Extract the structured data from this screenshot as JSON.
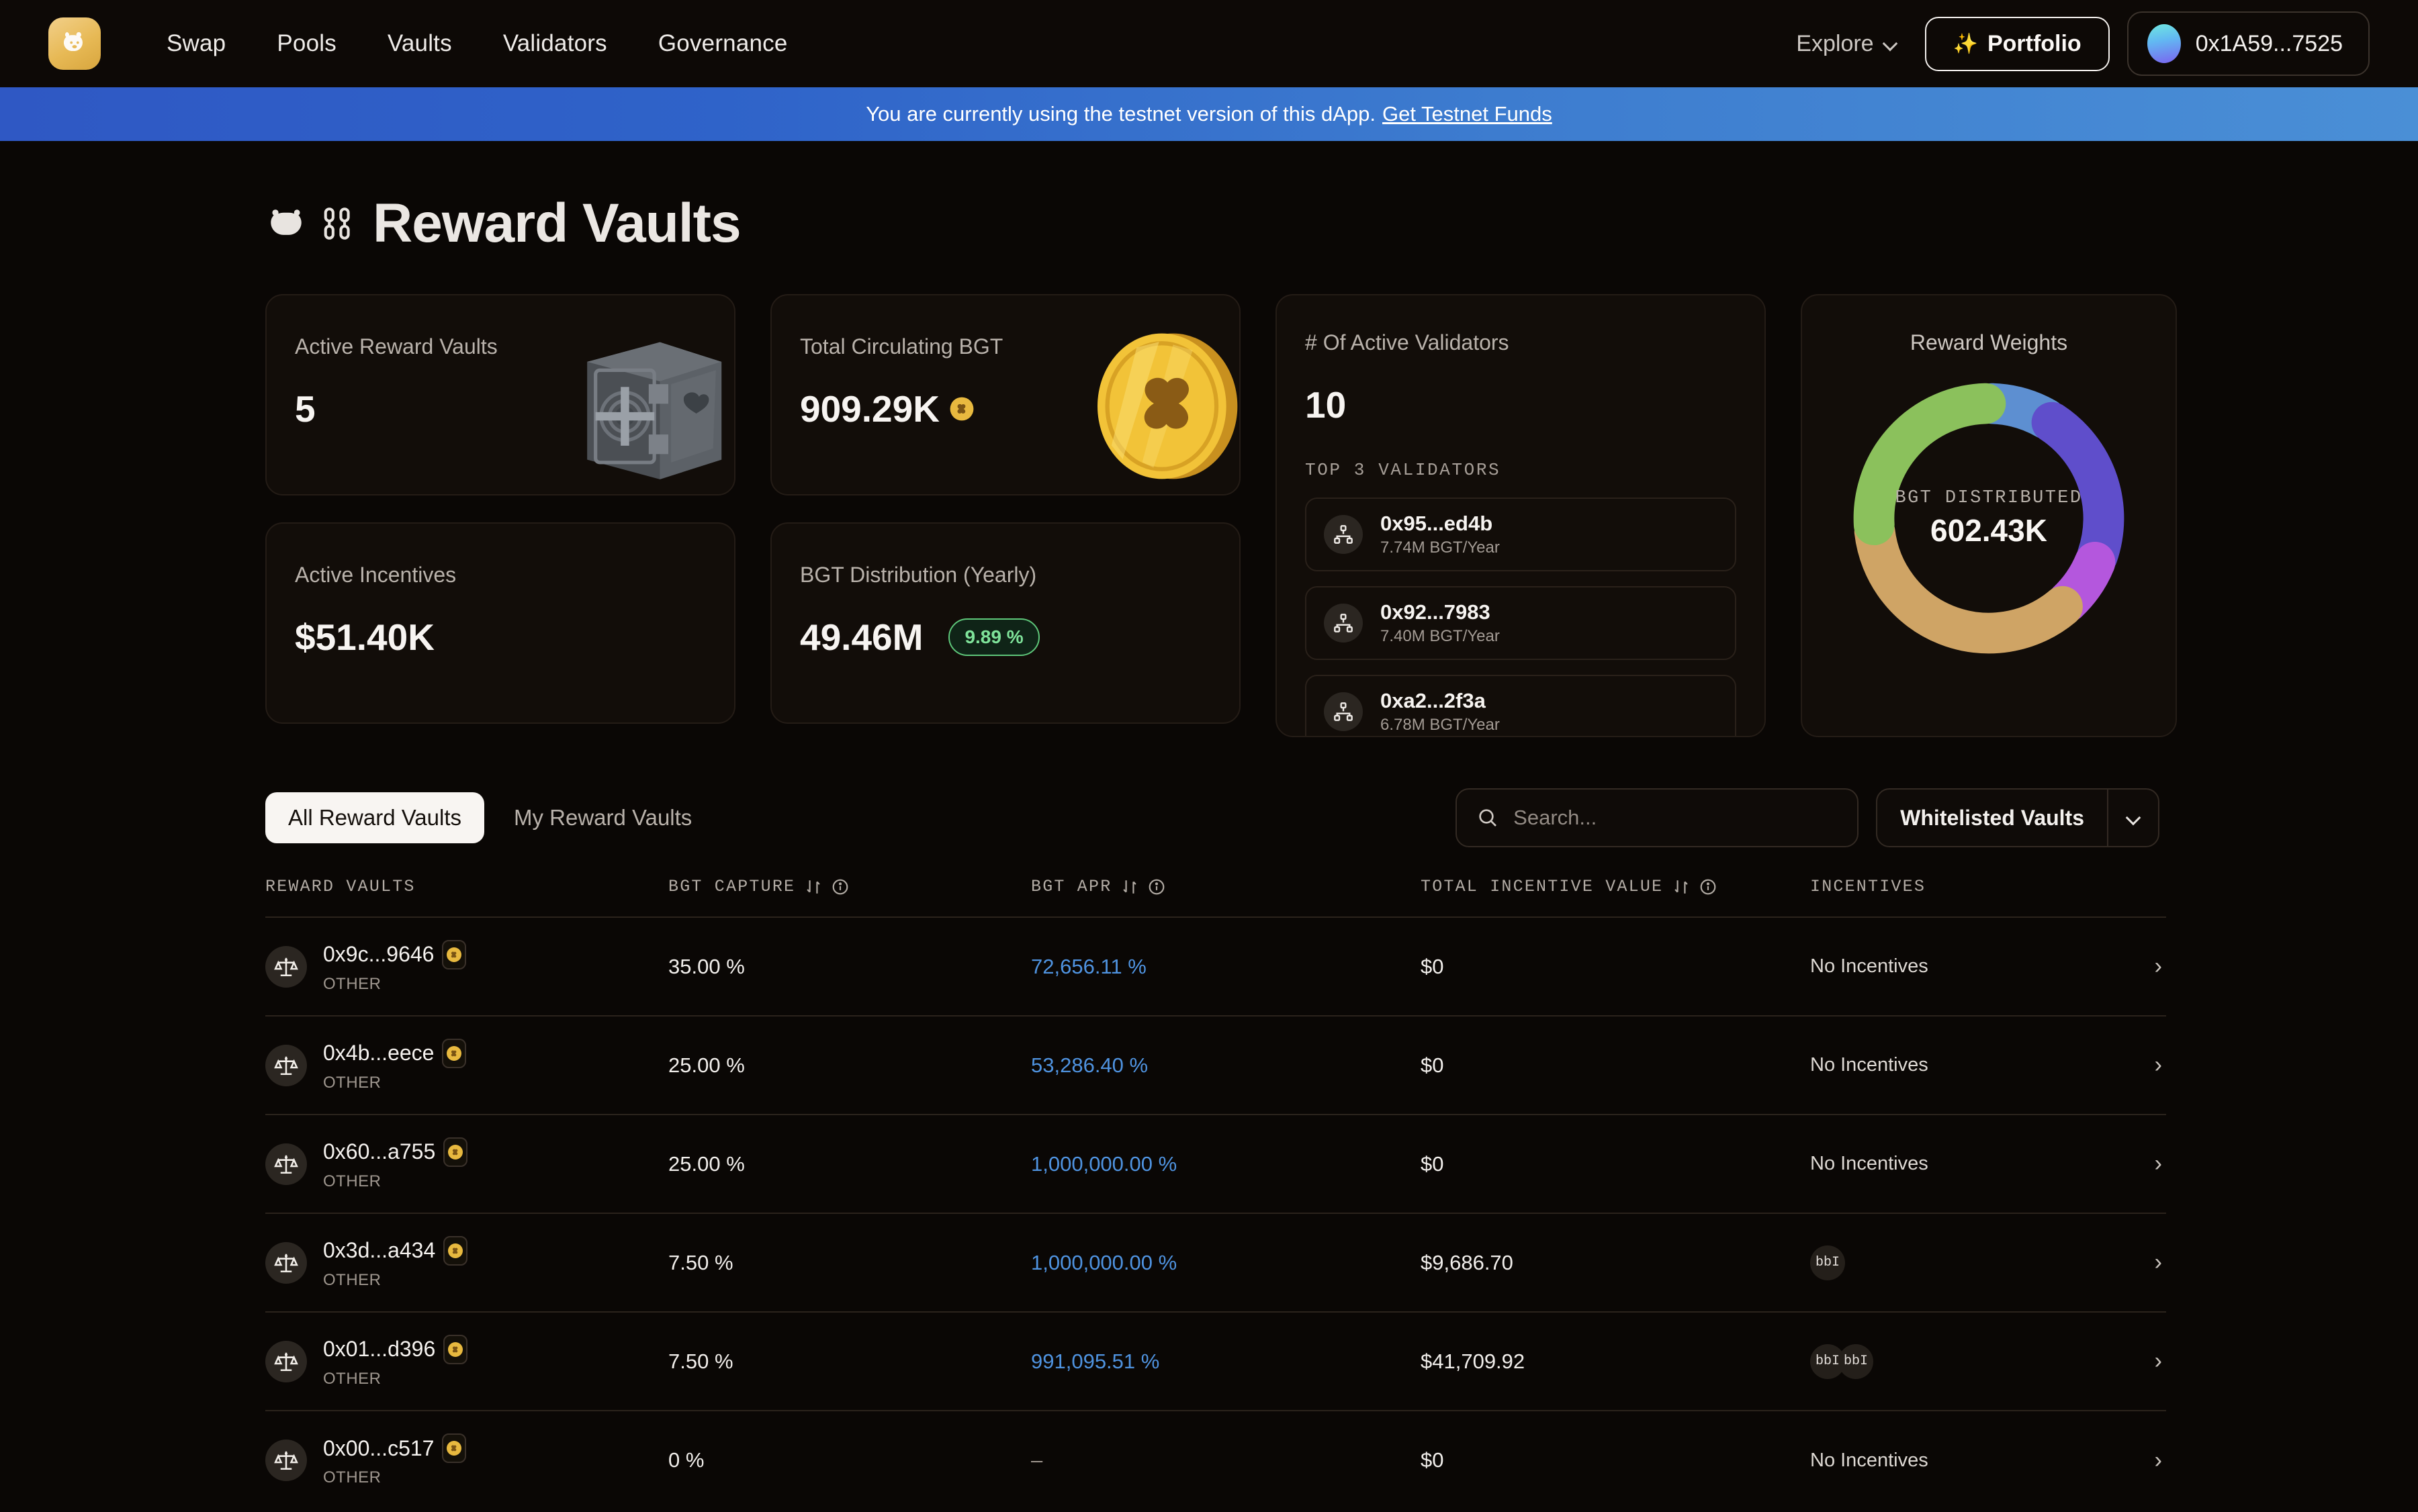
{
  "nav": {
    "logo_icon": "bera-logo-icon",
    "links": [
      "Swap",
      "Pools",
      "Vaults",
      "Validators",
      "Governance"
    ],
    "explore_label": "Explore",
    "portfolio_label": "Portfolio",
    "wallet_address": "0x1A59...7525"
  },
  "banner": {
    "text": "You are currently using the testnet version of this dApp.",
    "link_label": "Get Testnet Funds"
  },
  "page": {
    "title": "Reward Vaults"
  },
  "stats": {
    "active_reward_vaults": {
      "label": "Active Reward Vaults",
      "value": "5"
    },
    "total_circulating_bgt": {
      "label": "Total Circulating BGT",
      "value": "909.29K"
    },
    "active_incentives": {
      "label": "Active Incentives",
      "value": "$51.40K"
    },
    "bgt_distribution": {
      "label": "BGT Distribution (Yearly)",
      "value": "49.46M",
      "badge": "9.89 %"
    },
    "validators": {
      "label": "# Of Active Validators",
      "value": "10",
      "sublabel": "TOP 3 VALIDATORS",
      "items": [
        {
          "name": "0x95...ed4b",
          "rate": "7.74M BGT/Year"
        },
        {
          "name": "0x92...7983",
          "rate": "7.40M BGT/Year"
        },
        {
          "name": "0xa2...2f3a",
          "rate": "6.78M BGT/Year"
        }
      ]
    },
    "reward_weights": {
      "title": "Reward Weights",
      "center_label": "BGT DISTRIBUTED",
      "center_value": "602.43K"
    }
  },
  "chart_data": {
    "type": "pie",
    "title": "Reward Weights",
    "center_label": "BGT DISTRIBUTED",
    "center_value": "602.43K",
    "legend": "none",
    "categories": [
      "segment-1",
      "segment-2",
      "segment-3",
      "segment-4",
      "segment-5"
    ],
    "values": [
      8,
      20,
      7,
      32,
      24
    ],
    "colors": [
      "#5d8fd1",
      "#5f4ecb",
      "#b457dd",
      "#cfa465",
      "#8bc15c"
    ]
  },
  "controls": {
    "tabs": [
      {
        "label": "All Reward Vaults",
        "active": true
      },
      {
        "label": "My Reward Vaults",
        "active": false
      }
    ],
    "search": {
      "placeholder": "Search...",
      "value": ""
    },
    "filter": {
      "selected": "Whitelisted Vaults"
    }
  },
  "table": {
    "columns": [
      {
        "label": "REWARD VAULTS",
        "sortable": false,
        "info": false
      },
      {
        "label": "BGT CAPTURE",
        "sortable": true,
        "info": true
      },
      {
        "label": "BGT APR",
        "sortable": true,
        "info": true
      },
      {
        "label": "TOTAL INCENTIVE VALUE",
        "sortable": true,
        "info": true
      },
      {
        "label": "INCENTIVES",
        "sortable": false,
        "info": false
      }
    ],
    "rows": [
      {
        "name": "0x9c...9646",
        "type": "OTHER",
        "capture": "35.00 %",
        "apr": "72,656.11 %",
        "apr_muted": false,
        "incentive_value": "$0",
        "incentives": "No Incentives",
        "chips": []
      },
      {
        "name": "0x4b...eece",
        "type": "OTHER",
        "capture": "25.00 %",
        "apr": "53,286.40 %",
        "apr_muted": false,
        "incentive_value": "$0",
        "incentives": "No Incentives",
        "chips": []
      },
      {
        "name": "0x60...a755",
        "type": "OTHER",
        "capture": "25.00 %",
        "apr": "1,000,000.00 %",
        "apr_muted": false,
        "incentive_value": "$0",
        "incentives": "No Incentives",
        "chips": []
      },
      {
        "name": "0x3d...a434",
        "type": "OTHER",
        "capture": "7.50 %",
        "apr": "1,000,000.00 %",
        "apr_muted": false,
        "incentive_value": "$9,686.70",
        "incentives": "",
        "chips": [
          "bbI"
        ]
      },
      {
        "name": "0x01...d396",
        "type": "OTHER",
        "capture": "7.50 %",
        "apr": "991,095.51 %",
        "apr_muted": false,
        "incentive_value": "$41,709.92",
        "incentives": "",
        "chips": [
          "bbI",
          "bbI"
        ]
      },
      {
        "name": "0x00...c517",
        "type": "OTHER",
        "capture": "0 %",
        "apr": "–",
        "apr_muted": true,
        "incentive_value": "$0",
        "incentives": "No Incentives",
        "chips": []
      }
    ]
  }
}
